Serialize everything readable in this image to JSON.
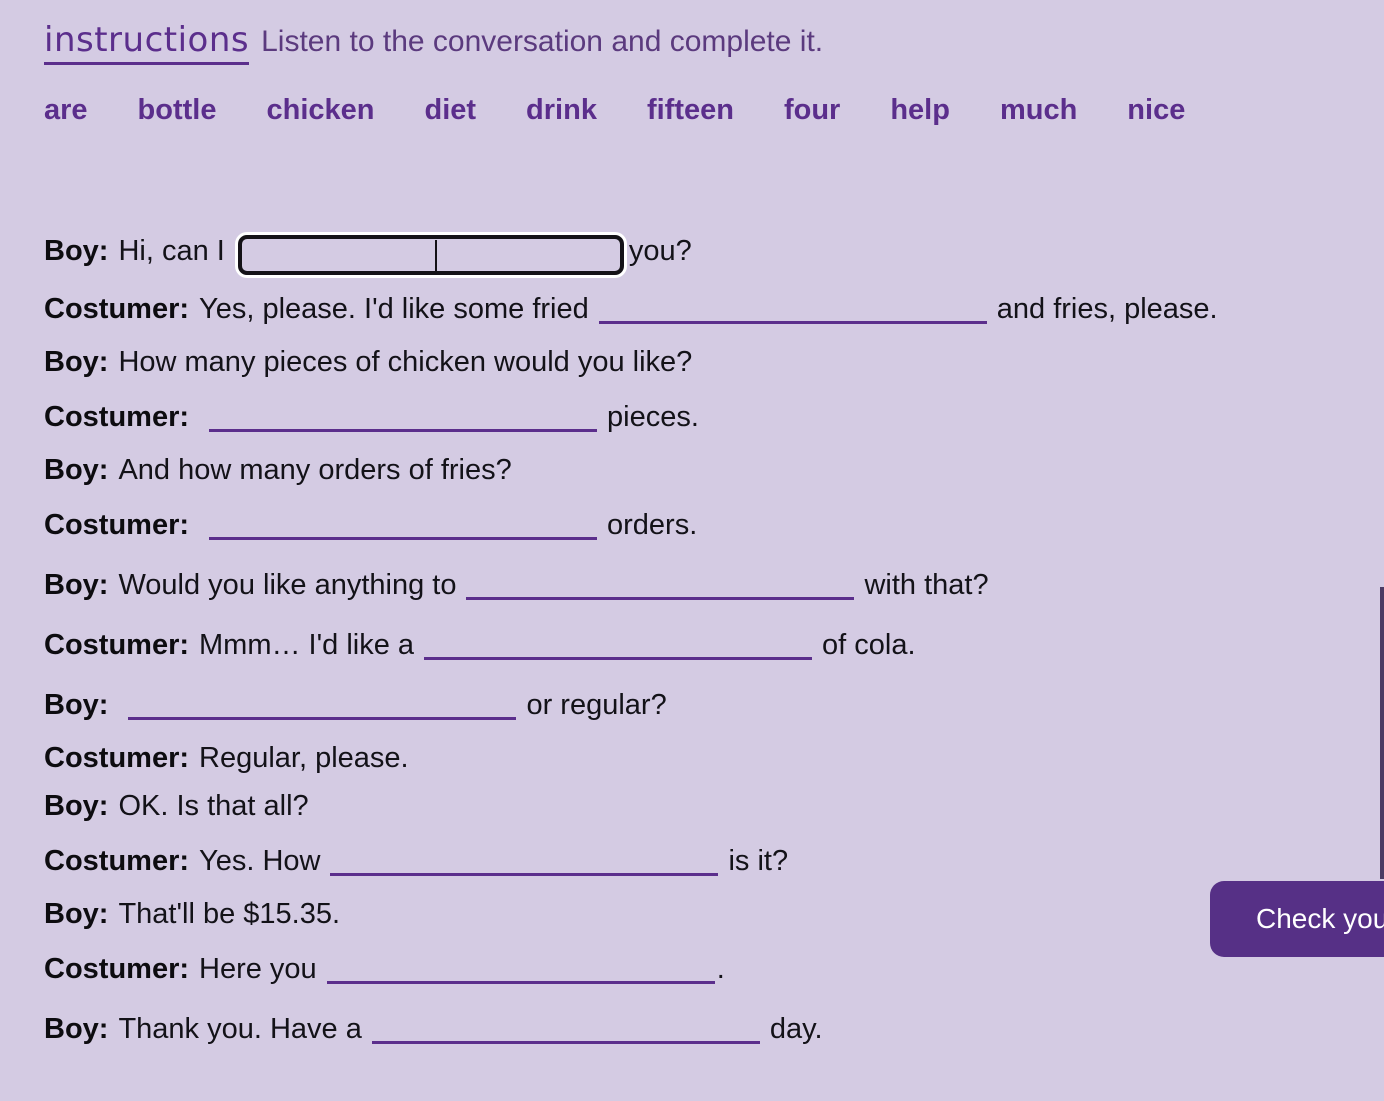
{
  "instructions": {
    "label": "Instructions",
    "text": "Listen to the conversation and complete it."
  },
  "word_bank": [
    {
      "word": "are"
    },
    {
      "word": "bottle"
    },
    {
      "word": "chicken"
    },
    {
      "word": "diet"
    },
    {
      "word": "drink"
    },
    {
      "word": "fifteen"
    },
    {
      "word": "four"
    },
    {
      "word": "help"
    },
    {
      "word": "much"
    },
    {
      "word": "nice"
    }
  ],
  "dialogue": [
    {
      "speaker": "Boy:",
      "pre": "Hi, can I",
      "post": "you?",
      "field_type": "input",
      "field_value": "",
      "field_placeholder": ""
    },
    {
      "speaker": "Costumer:",
      "pre": "Yes, please. I'd like some fried",
      "post": "and fries, please.",
      "field_type": "blank",
      "field_value": ""
    },
    {
      "speaker": "Boy:",
      "pre": "How many pieces of chicken would you like?",
      "post": "",
      "field_type": "none"
    },
    {
      "speaker": "Costumer:",
      "pre": "",
      "post": "pieces.",
      "field_type": "blank",
      "field_value": ""
    },
    {
      "speaker": "Boy:",
      "pre": "And how many orders of fries?",
      "post": "",
      "field_type": "none"
    },
    {
      "speaker": "Costumer:",
      "pre": "",
      "post": "orders.",
      "field_type": "blank",
      "field_value": ""
    },
    {
      "speaker": "Boy:",
      "pre": "Would you like anything to",
      "post": "with that?",
      "field_type": "blank",
      "field_value": ""
    },
    {
      "speaker": "Costumer:",
      "pre": "Mmm… I'd like a",
      "post": "of cola.",
      "field_type": "blank",
      "field_value": ""
    },
    {
      "speaker": "Boy:",
      "pre": "",
      "post": "or regular?",
      "field_type": "blank",
      "field_value": ""
    },
    {
      "speaker": "Costumer:",
      "pre": "Regular, please.",
      "post": "",
      "field_type": "none"
    },
    {
      "speaker": "Boy:",
      "pre": "OK. Is that all?",
      "post": "",
      "field_type": "none"
    },
    {
      "speaker": "Costumer:",
      "pre": "Yes. How",
      "post": "is it?",
      "field_type": "blank",
      "field_value": ""
    },
    {
      "speaker": "Boy:",
      "pre": "That'll be $15.35.",
      "post": "",
      "field_type": "none"
    },
    {
      "speaker": "Costumer:",
      "pre": "Here you",
      "post": ".",
      "field_type": "blank",
      "field_value": ""
    },
    {
      "speaker": "Boy:",
      "pre": "Thank you. Have a",
      "post": "day.",
      "field_type": "blank",
      "field_value": ""
    }
  ],
  "check_button": {
    "label": "Check your answers"
  },
  "colors": {
    "background": "#d4cbe3",
    "accent_purple": "#5b2e8c",
    "instruction_text": "#5b3a7e",
    "button_background": "#563086",
    "button_text": "#ffffff",
    "body_text": "#131218",
    "input_border": "#141217"
  }
}
